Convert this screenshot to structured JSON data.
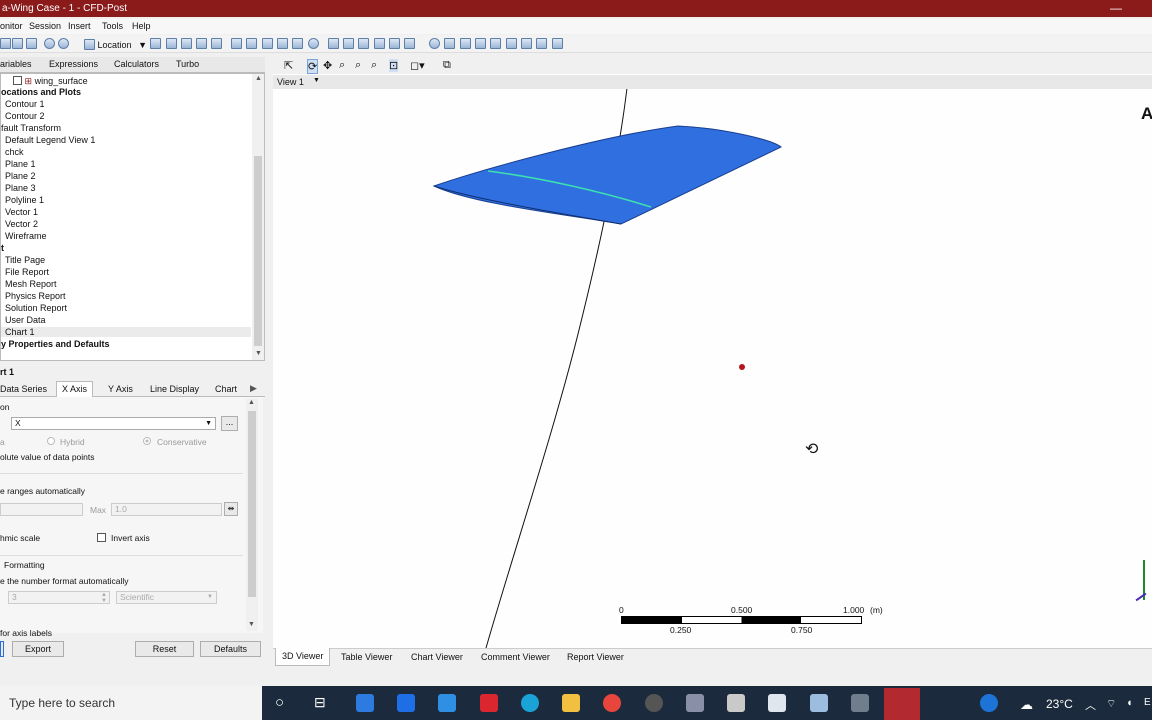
{
  "window": {
    "title": "a-Wing Case - 1 - CFD-Post",
    "minimize_glyph": "—"
  },
  "menu": [
    "onitor",
    "Session",
    "Insert",
    "Tools",
    "Help"
  ],
  "toolbar": {
    "location_label": "Location",
    "location_caret": "▼"
  },
  "outline_tabs": [
    "ariables",
    "Expressions",
    "Calculators",
    "Turbo"
  ],
  "tree": {
    "wing_surface": "wing_surface",
    "user_locations": "ocations and Plots",
    "items": [
      "Contour 1",
      "Contour 2"
    ],
    "default_transform": "fault Transform",
    "items2": [
      "Default Legend View 1",
      "chck",
      "Plane 1",
      "Plane 2",
      "Plane 3",
      "Polyline 1",
      "Vector 1",
      "Vector 2",
      "Wireframe"
    ],
    "report": "t",
    "report_items": [
      "Title Page",
      "File Report",
      "Mesh Report",
      "Physics Report",
      "Solution Report",
      "User Data",
      "Chart 1"
    ],
    "display_props": "y Properties and Defaults"
  },
  "details": {
    "title": "rt 1",
    "tabs": [
      "Data Series",
      "X Axis",
      "Y Axis",
      "Line Display",
      "Chart"
    ],
    "active_tab": "X Axis",
    "section_label": "on",
    "variable_value": "X",
    "ellipsis": "...",
    "radio_hybrid": "Hybrid",
    "radio_conservative": "Conservative",
    "radio_left": "a",
    "abs_value": "olute value of data points",
    "ranges_auto": "e ranges automatically",
    "max_label": "Max",
    "max_value": "1.0",
    "log_scale": "hmic scale",
    "invert_axis": "Invert axis",
    "formatting": "Formatting",
    "number_format": "e the number format automatically",
    "precision": "3",
    "format_type": "Scientific",
    "axis_labels": "for axis labels"
  },
  "buttons": {
    "export": "Export",
    "reset": "Reset",
    "defaults": "Defaults"
  },
  "viewer": {
    "view_name": "View 1",
    "view_caret": "▼",
    "corner_letter": "A",
    "scale": {
      "t0": "0",
      "t1": "0.250",
      "t2": "0.500",
      "t3": "0.750",
      "t4": "1.000",
      "unit": "(m)"
    },
    "tabs": [
      "3D Viewer",
      "Table Viewer",
      "Chart Viewer",
      "Comment Viewer",
      "Report Viewer"
    ],
    "active_tab": "3D Viewer"
  },
  "taskbar": {
    "search_placeholder": "Type here to search",
    "temperature": "23°C",
    "tray_end": "E"
  },
  "colors": {
    "titlebar": "#8b1a1a",
    "wing": "#2f6fe0",
    "streamline": "#3de0b0",
    "taskbar": "#1c2a3d"
  }
}
